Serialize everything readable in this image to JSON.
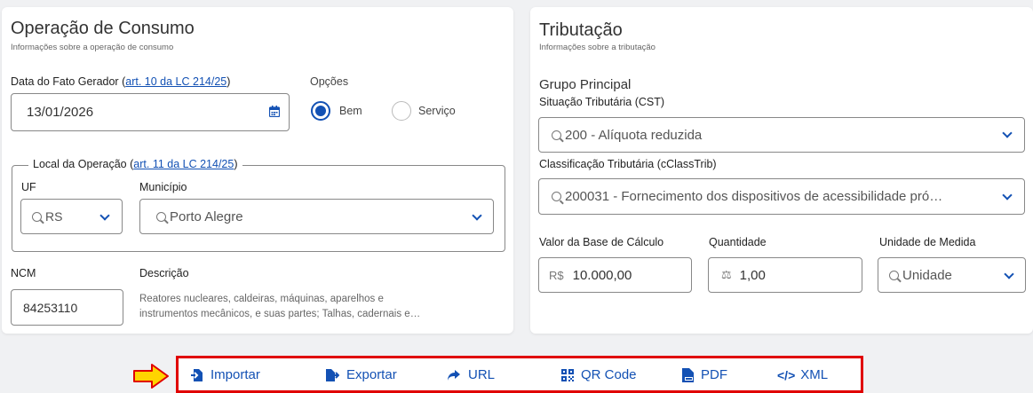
{
  "left": {
    "title": "Operação de Consumo",
    "subtitle": "Informações sobre a operação de consumo",
    "date_label": "Data do Fato Gerador ",
    "date_link": "art. 10 da LC 214/25",
    "date_value": "13/01/2026",
    "options_label": "Opções",
    "option_bem": "Bem",
    "option_servico": "Serviço",
    "local_label": "Local da Operação ",
    "local_link": "art. 11 da LC 214/25",
    "uf_label": "UF",
    "uf_value": "RS",
    "municipio_label": "Município",
    "municipio_value": "Porto Alegre",
    "ncm_label": "NCM",
    "ncm_value": "84253110",
    "descricao_label": "Descrição",
    "descricao_line1": "Reatores nucleares, caldeiras, máquinas, aparelhos e",
    "descricao_line2": "instrumentos mecânicos, e suas partes; Talhas, cadernais e…"
  },
  "right": {
    "title": "Tributação",
    "subtitle": "Informações sobre a tributação",
    "group_label": "Grupo Principal",
    "cst_label": "Situação Tributária (CST)",
    "cst_value": "200 - Alíquota reduzida",
    "class_label": "Classificação Tributária (cClassTrib)",
    "class_value": "200031 - Fornecimento dos dispositivos de acessibilidade pró…",
    "base_label": "Valor da Base de Cálculo",
    "base_prefix": "R$",
    "base_value": "10.000,00",
    "qty_label": "Quantidade",
    "qty_value": "1,00",
    "unit_label": "Unidade de Medida",
    "unit_value": "Unidade"
  },
  "toolbar": {
    "importar": "Importar",
    "exportar": "Exportar",
    "url": "URL",
    "qrcode": "QR Code",
    "pdf": "PDF",
    "xml": "XML"
  },
  "colors": {
    "accent": "#1351b4",
    "highlight_border": "#e00000",
    "arrow_fill": "#ffd400",
    "arrow_stroke": "#e00000"
  }
}
